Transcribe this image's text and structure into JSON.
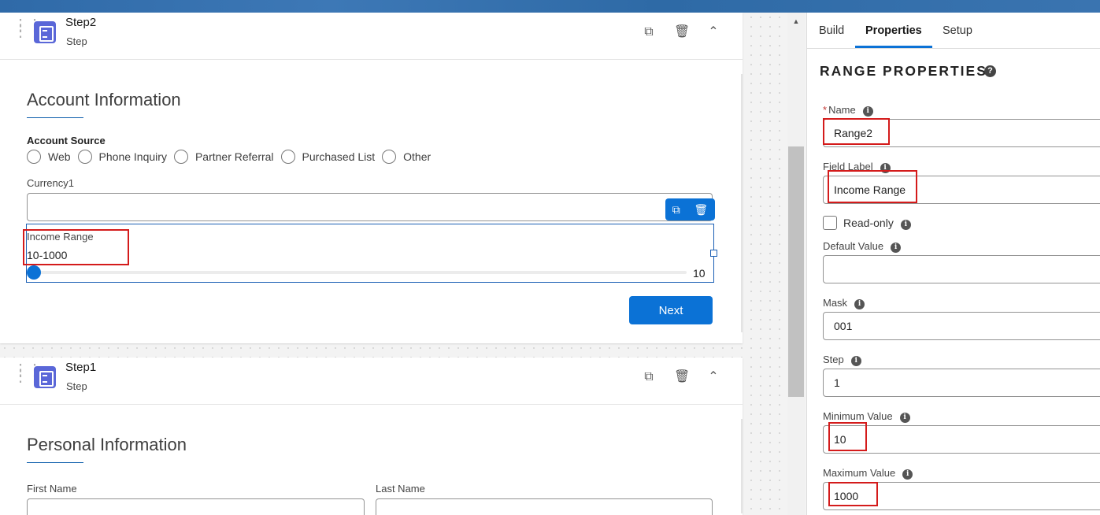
{
  "canvas": {
    "steps": [
      {
        "title": "Step2",
        "subtitle": "Step",
        "section_title": "Account Information",
        "account_source": {
          "label": "Account Source",
          "options": [
            "Web",
            "Phone Inquiry",
            "Partner Referral",
            "Purchased List",
            "Other"
          ]
        },
        "currency": {
          "label": "Currency1",
          "value": ""
        },
        "range": {
          "label": "Income Range",
          "range_text": "10-1000",
          "value": "10",
          "min": 10,
          "max": 1000
        },
        "next_label": "Next"
      },
      {
        "title": "Step1",
        "subtitle": "Step",
        "section_title": "Personal Information",
        "first_name_label": "First Name",
        "last_name_label": "Last Name"
      }
    ]
  },
  "panel": {
    "tabs": [
      "Build",
      "Properties",
      "Setup"
    ],
    "active_tab": "Properties",
    "title": "RANGE PROPERTIES",
    "fields": {
      "name": {
        "label": "Name",
        "required_mark": "*",
        "value": "Range2"
      },
      "field_label": {
        "label": "Field Label",
        "value": "Income Range"
      },
      "read_only": {
        "label": "Read-only",
        "checked": false
      },
      "default_value": {
        "label": "Default Value",
        "value": ""
      },
      "mask": {
        "label": "Mask",
        "value": "001"
      },
      "step": {
        "label": "Step",
        "value": "1"
      },
      "min": {
        "label": "Minimum Value",
        "value": "10"
      },
      "max": {
        "label": "Maximum Value",
        "value": "1000"
      }
    }
  },
  "colors": {
    "brand": "#0b72d6",
    "highlight": "#d41b1b",
    "step_icon": "#5a67d8"
  }
}
